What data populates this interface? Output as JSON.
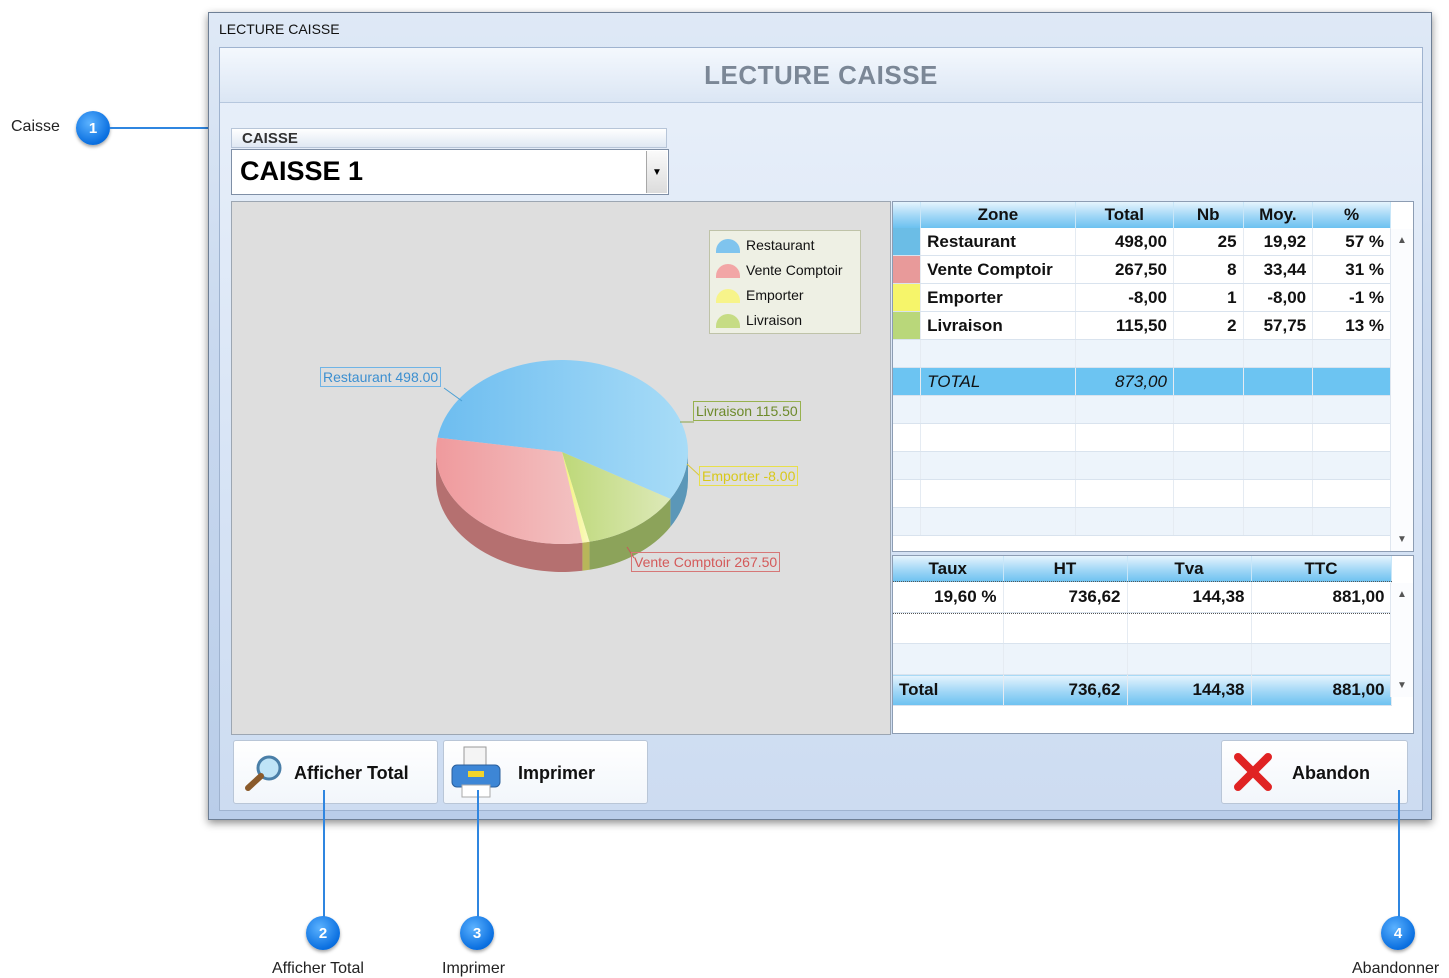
{
  "window": {
    "title": "LECTURE CAISSE",
    "header": "LECTURE CAISSE"
  },
  "caisse": {
    "label": "CAISSE",
    "value": "CAISSE 1"
  },
  "chart_data": {
    "type": "pie",
    "title": "",
    "legend_position": "top-right",
    "series": [
      {
        "name": "Restaurant",
        "value": 498.0,
        "label": "Restaurant 498.00",
        "color": "#7fcaf2"
      },
      {
        "name": "Vente Comptoir",
        "value": 267.5,
        "label": "Vente Comptoir 267.50",
        "color": "#f2a6a6"
      },
      {
        "name": "Emporter",
        "value": -8.0,
        "label": "Emporter -8.00",
        "color": "#f7f48a"
      },
      {
        "name": "Livraison",
        "value": 115.5,
        "label": "Livraison 115.50",
        "color": "#c6dc84"
      }
    ]
  },
  "zones": {
    "columns": [
      "Zone",
      "Total",
      "Nb",
      "Moy.",
      "%"
    ],
    "rows": [
      {
        "color": "#6bbde6",
        "zone": "Restaurant",
        "total": "498,00",
        "nb": "25",
        "moy": "19,92",
        "pct": "57 %"
      },
      {
        "color": "#e89a9a",
        "zone": "Vente Comptoir",
        "total": "267,50",
        "nb": "8",
        "moy": "33,44",
        "pct": "31 %"
      },
      {
        "color": "#f6f56a",
        "zone": "Emporter",
        "total": "-8,00",
        "nb": "1",
        "moy": "-8,00",
        "pct": "-1 %"
      },
      {
        "color": "#b9d77a",
        "zone": "Livraison",
        "total": "115,50",
        "nb": "2",
        "moy": "57,75",
        "pct": "13 %"
      }
    ],
    "total_label": "TOTAL",
    "total_value": "873,00"
  },
  "tva": {
    "columns": [
      "Taux",
      "HT",
      "Tva",
      "TTC"
    ],
    "rows": [
      {
        "taux": "19,60 %",
        "ht": "736,62",
        "tva": "144,38",
        "ttc": "881,00"
      }
    ],
    "footer": {
      "label": "Total",
      "ht": "736,62",
      "tva": "144,38",
      "ttc": "881,00"
    }
  },
  "buttons": {
    "afficher_total": "Afficher Total",
    "imprimer": "Imprimer",
    "abandon": "Abandon"
  },
  "callouts": {
    "c1": {
      "number": "1",
      "label": "Caisse"
    },
    "c2": {
      "number": "2",
      "label": "Afficher Total"
    },
    "c3": {
      "number": "3",
      "label": "Imprimer"
    },
    "c4": {
      "number": "4",
      "label": "Abandonner"
    }
  },
  "icons": {
    "chevron": "chevron-down-icon",
    "scroll_up": "scroll-up-icon",
    "scroll_down": "scroll-down-icon",
    "search": "magnifier-icon",
    "printer": "printer-icon",
    "close": "red-x-icon"
  }
}
